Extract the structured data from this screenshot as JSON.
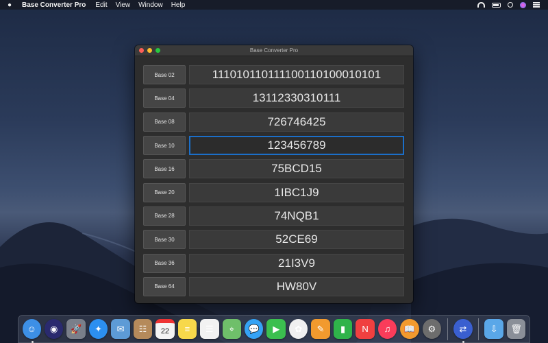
{
  "menubar": {
    "app_name": "Base Converter Pro",
    "items": [
      "Edit",
      "View",
      "Window",
      "Help"
    ]
  },
  "window": {
    "title": "Base Converter Pro",
    "rows": [
      {
        "label": "Base 02",
        "value": "111010110111100110100010101"
      },
      {
        "label": "Base 04",
        "value": "13112330310111"
      },
      {
        "label": "Base 08",
        "value": "726746425"
      },
      {
        "label": "Base 10",
        "value": "123456789",
        "focused": true
      },
      {
        "label": "Base 16",
        "value": "75BCD15"
      },
      {
        "label": "Base 20",
        "value": "1IBC1J9"
      },
      {
        "label": "Base 28",
        "value": "74NQB1"
      },
      {
        "label": "Base 30",
        "value": "52CE69"
      },
      {
        "label": "Base 36",
        "value": "21I3V9"
      },
      {
        "label": "Base 64",
        "value": "HW80V"
      }
    ]
  },
  "calendar_day": "22",
  "dock": [
    {
      "name": "finder-icon",
      "color": "#3d8fe6",
      "glyph": "☺",
      "running": true
    },
    {
      "name": "siri-icon",
      "color": "#2a2a6e",
      "glyph": "◉"
    },
    {
      "name": "launchpad-icon",
      "color": "#7a7f8a",
      "glyph": "🚀"
    },
    {
      "name": "safari-icon",
      "color": "#2c8ff0",
      "glyph": "✦"
    },
    {
      "name": "mail-stamp-icon",
      "color": "#5d9bd6",
      "glyph": "✉"
    },
    {
      "name": "contacts-icon",
      "color": "#b58a5b",
      "glyph": "☷"
    },
    {
      "name": "calendar-icon",
      "color": "#f4f4f4",
      "glyph": "22"
    },
    {
      "name": "notes-icon",
      "color": "#f7d84b",
      "glyph": "≡"
    },
    {
      "name": "reminders-icon",
      "color": "#f2f2f2",
      "glyph": "☰"
    },
    {
      "name": "maps-icon",
      "color": "#6fbf6a",
      "glyph": "⌖"
    },
    {
      "name": "messages-icon",
      "color": "#35a3f5",
      "glyph": "💬"
    },
    {
      "name": "facetime-icon",
      "color": "#3bbf4f",
      "glyph": "▶"
    },
    {
      "name": "photos-icon",
      "color": "#f0f0f0",
      "glyph": "✿"
    },
    {
      "name": "pages-icon",
      "color": "#f29a2e",
      "glyph": "✎"
    },
    {
      "name": "numbers-icon",
      "color": "#2fb34a",
      "glyph": "▮"
    },
    {
      "name": "news-icon",
      "color": "#f04040",
      "glyph": "N"
    },
    {
      "name": "music-icon",
      "color": "#fa3c5a",
      "glyph": "♫"
    },
    {
      "name": "books-icon",
      "color": "#f29a2e",
      "glyph": "📖"
    },
    {
      "name": "system-preferences-icon",
      "color": "#6d6d6d",
      "glyph": "⚙"
    },
    {
      "name": "base-converter-app-icon",
      "color": "#3a5fd0",
      "glyph": "⇄",
      "running": true
    },
    {
      "name": "downloads-folder-icon",
      "color": "#5aa7e8",
      "glyph": "⇩"
    },
    {
      "name": "trash-icon",
      "color": "#8a8f98",
      "glyph": "🗑"
    }
  ],
  "colors": {
    "window_bg": "#2d2d2d",
    "focus_ring": "#1b6fc9",
    "button_bg": "#454545"
  }
}
